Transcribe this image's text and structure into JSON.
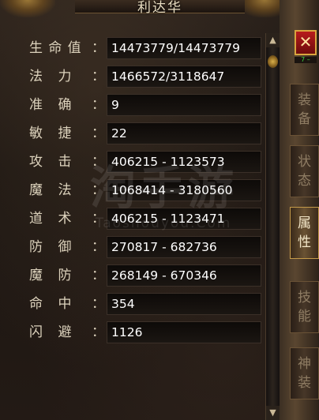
{
  "window": {
    "title": "利达华"
  },
  "close": {
    "label": "✕",
    "sub": "7 –"
  },
  "stats": [
    {
      "label": [
        "生",
        "命",
        "值"
      ],
      "value": "14473779/14473779"
    },
    {
      "label": [
        "法",
        "力"
      ],
      "value": "1466572/3118647"
    },
    {
      "label": [
        "准",
        "确"
      ],
      "value": "9"
    },
    {
      "label": [
        "敏",
        "捷"
      ],
      "value": "22"
    },
    {
      "label": [
        "攻",
        "击"
      ],
      "value": "406215 - 1123573"
    },
    {
      "label": [
        "魔",
        "法"
      ],
      "value": "1068414 - 3180560"
    },
    {
      "label": [
        "道",
        "术"
      ],
      "value": "406215 - 1123471"
    },
    {
      "label": [
        "防",
        "御"
      ],
      "value": "270817 - 682736"
    },
    {
      "label": [
        "魔",
        "防"
      ],
      "value": "268149 - 670346"
    },
    {
      "label": [
        "命",
        "中"
      ],
      "value": "354"
    },
    {
      "label": [
        "闪",
        "避"
      ],
      "value": "1126"
    }
  ],
  "colon": "：",
  "tabs": [
    {
      "label": "装备",
      "active": false
    },
    {
      "label": "状态",
      "active": false
    },
    {
      "label": "属性",
      "active": true
    },
    {
      "label": "技能",
      "active": false
    },
    {
      "label": "神装",
      "active": false
    }
  ],
  "scroll": {
    "up": "▲",
    "down": "▼"
  },
  "watermark": {
    "main": "淘手游",
    "sub": "Taoshouyou.Com"
  },
  "colors": {
    "accent": "#c49a4a",
    "close": "#b81c1c",
    "value_text": "#ffffff",
    "label_text": "#ddd3bd"
  }
}
